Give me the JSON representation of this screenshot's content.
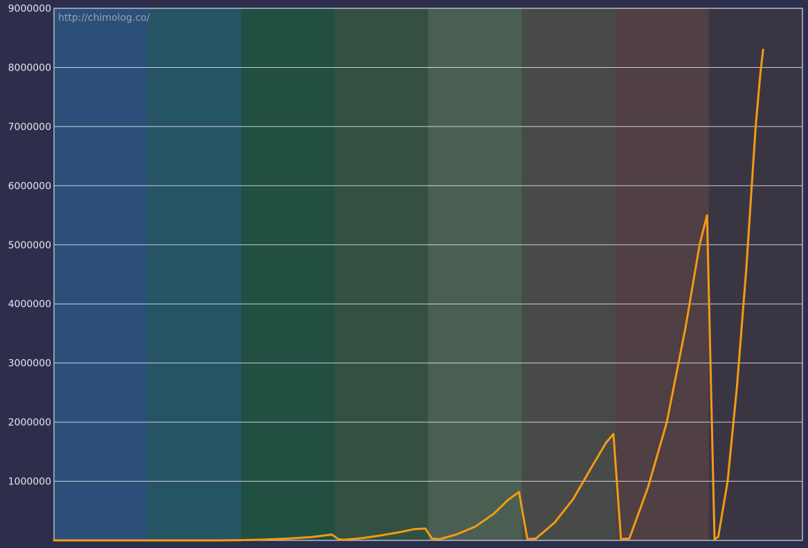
{
  "watermark": "http://chimolog.co/",
  "colors": {
    "background": "#2d2e4c",
    "line": "#f39c12",
    "gridline": "#e8e8ee",
    "frame": "#b7bac8",
    "bands": [
      "#2c4f7a",
      "#255564",
      "#214f42",
      "#335040",
      "#4a5f51",
      "#484a47",
      "#503f43",
      "#3a3543"
    ]
  },
  "chart_data": {
    "type": "line",
    "title": "",
    "xlabel": "",
    "ylabel": "",
    "ylim": [
      0,
      9000000
    ],
    "xlim": [
      0,
      8
    ],
    "yticks": [
      {
        "value": 1000000,
        "label": "1000000"
      },
      {
        "value": 2000000,
        "label": "2000000"
      },
      {
        "value": 3000000,
        "label": "3000000"
      },
      {
        "value": 4000000,
        "label": "4000000"
      },
      {
        "value": 5000000,
        "label": "5000000"
      },
      {
        "value": 6000000,
        "label": "6000000"
      },
      {
        "value": 7000000,
        "label": "7000000"
      },
      {
        "value": 8000000,
        "label": "8000000"
      },
      {
        "value": 9000000,
        "label": "9000000"
      }
    ],
    "grid": true,
    "legend": "none",
    "background_bands": 8,
    "series": [
      {
        "x": [
          0,
          1,
          1.75,
          2,
          2.25,
          2.5,
          2.75,
          2.97,
          3.04,
          3.1,
          3.3,
          3.5,
          3.7,
          3.85,
          3.97,
          4.04,
          4.12,
          4.3,
          4.5,
          4.7,
          4.85,
          4.97,
          5.06,
          5.15,
          5.35,
          5.55,
          5.75,
          5.9,
          5.98,
          6.06,
          6.15,
          6.35,
          6.55,
          6.75,
          6.9,
          6.98,
          7.06,
          7.1,
          7.2,
          7.3,
          7.4,
          7.5,
          7.55,
          7.58
        ],
        "y": [
          0,
          0,
          0,
          5000,
          15000,
          30000,
          55000,
          100000,
          20000,
          10000,
          40000,
          85000,
          140000,
          190000,
          200000,
          30000,
          20000,
          100000,
          230000,
          450000,
          680000,
          820000,
          20000,
          30000,
          300000,
          700000,
          1250000,
          1650000,
          1800000,
          20000,
          30000,
          900000,
          2000000,
          3600000,
          5000000,
          5500000,
          20000,
          60000,
          1000000,
          2600000,
          4600000,
          7000000,
          7900000,
          8300000
        ]
      }
    ]
  }
}
